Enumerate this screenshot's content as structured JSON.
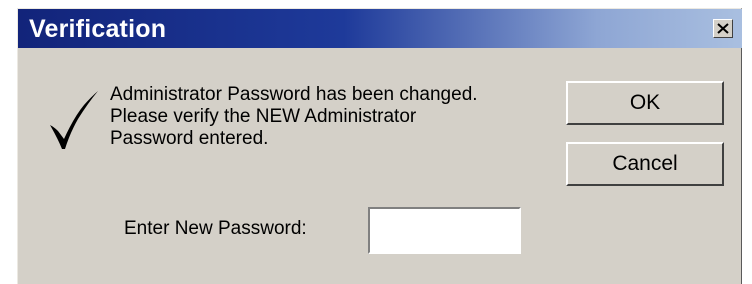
{
  "window": {
    "title": "Verification",
    "close_icon": "close-icon",
    "title_gradient": [
      "#12247a",
      "#a9bfe0"
    ],
    "background": "#d4d0c8"
  },
  "message": {
    "icon": "checkmark-icon",
    "lines": [
      "Administrator Password has been changed.",
      "Please verify the NEW Administrator",
      "Password entered."
    ]
  },
  "buttons": {
    "ok_label": "OK",
    "cancel_label": "Cancel"
  },
  "password": {
    "label": "Enter New Password:",
    "value": ""
  }
}
